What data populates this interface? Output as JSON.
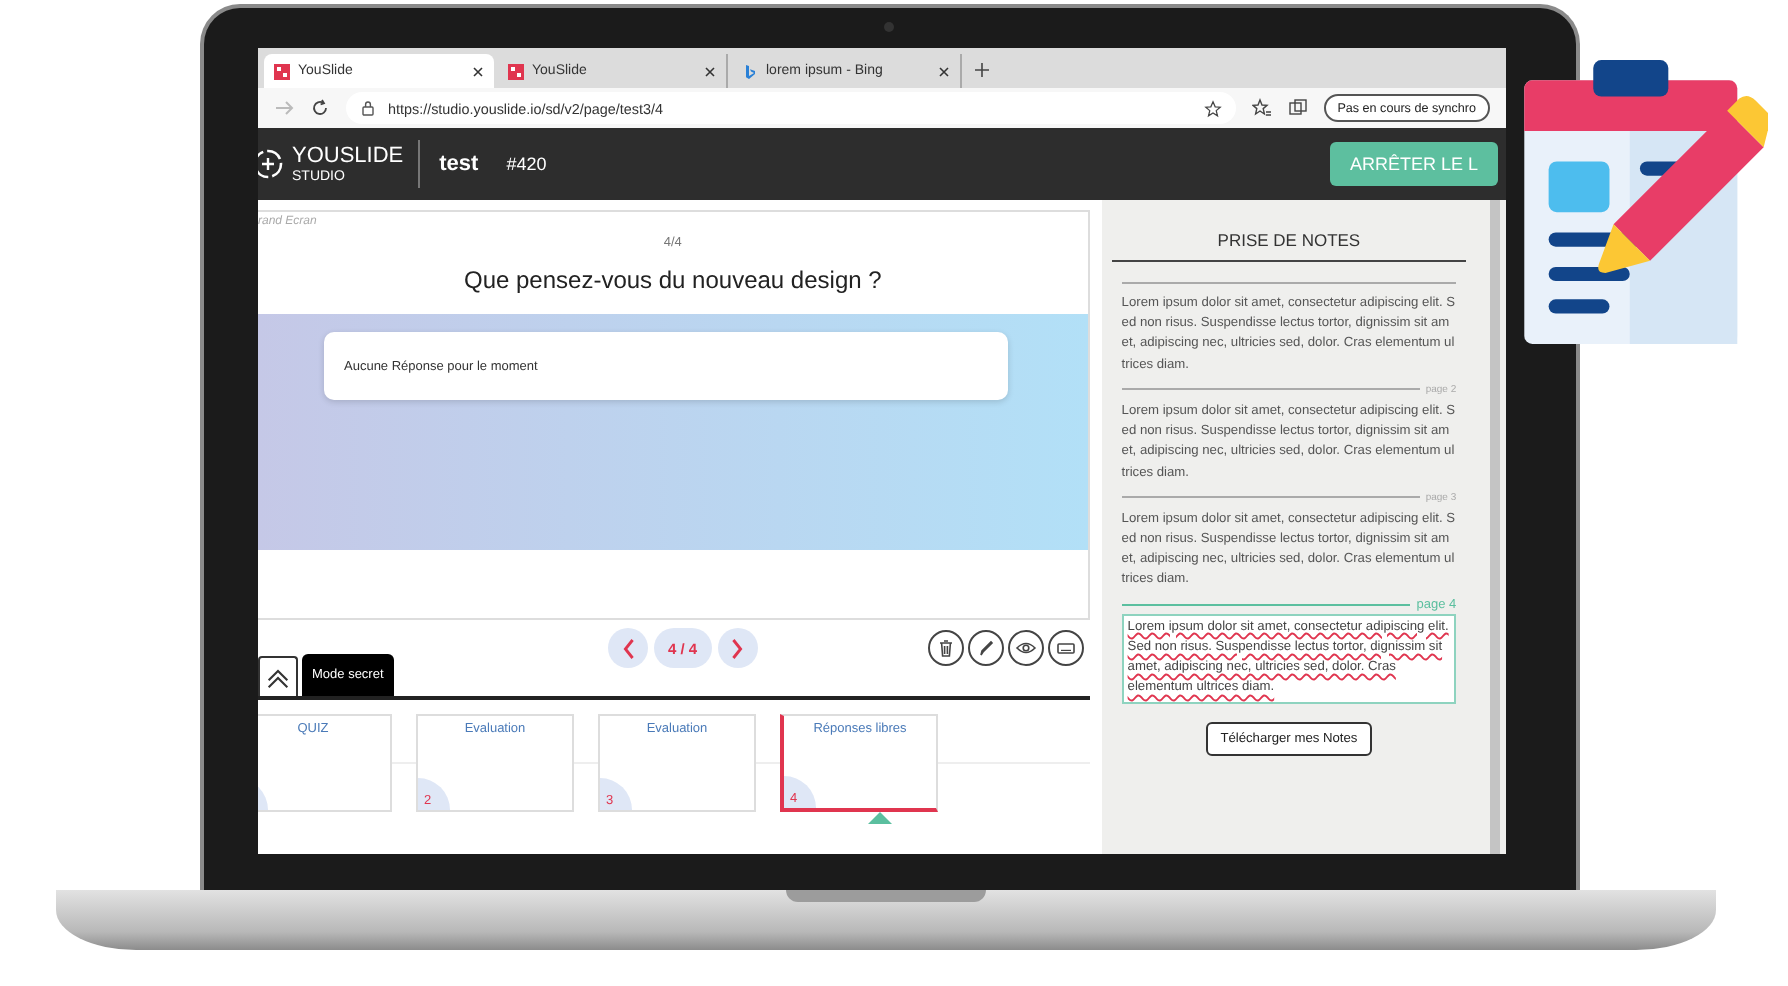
{
  "browser": {
    "tabs": [
      {
        "label": "YouSlide",
        "kind": "youslide",
        "selected": true
      },
      {
        "label": "YouSlide",
        "kind": "youslide",
        "selected": false
      },
      {
        "label": "lorem ipsum - Bing",
        "kind": "bing",
        "selected": false
      }
    ],
    "address": "https://studio.youslide.io/sd/v2/page/test3/4",
    "sync_button": "Pas en cours de synchro"
  },
  "header": {
    "logo_name": "YOUSLIDE",
    "logo_sub": "STUDIO",
    "title": "test",
    "code": "#420",
    "stop_button": "ARRÊTER LE L"
  },
  "slide": {
    "corner_label": "rand Ecran",
    "counter": "4/4",
    "question": "Que pensez-vous du nouveau design ?",
    "message": "Aucune Réponse pour le moment"
  },
  "controls": {
    "mode_button": "Mode secret",
    "page": "4 / 4"
  },
  "thumbnails": [
    {
      "title": "QUIZ",
      "selected": false
    },
    {
      "title": "Evaluation",
      "number": "2",
      "selected": false
    },
    {
      "title": "Evaluation",
      "number": "3",
      "selected": false
    },
    {
      "title": "Réponses libres",
      "number": "4",
      "selected": true
    }
  ],
  "notes": {
    "title": "PRISE DE NOTES",
    "pages": [
      {
        "text": "Lorem ipsum dolor sit amet, consectetur adipiscing elit. Sed non risus. Suspendisse lectus tortor, dignissim sit amet, adipiscing nec, ultricies sed, dolor. Cras elementum ultrices diam.",
        "selected": false
      },
      {
        "label": "page 2",
        "text": "Lorem ipsum dolor sit amet, consectetur adipiscing elit. Sed non risus. Suspendisse lectus tortor, dignissim sit amet, adipiscing nec, ultricies sed, dolor. Cras elementum ultrices diam.",
        "selected": false
      },
      {
        "label": "page 3",
        "text": "Lorem ipsum dolor sit amet, consectetur adipiscing elit. Sed non risus. Suspendisse lectus tortor, dignissim sit amet, adipiscing nec, ultricies sed, dolor. Cras elementum ultrices diam.",
        "selected": false
      },
      {
        "label": "page 4",
        "text": "Lorem ipsum dolor sit amet, consectetur adipiscing elit. Sed non risus. Suspendisse lectus tortor, dignissim sit amet, adipiscing nec, ultricies sed, dolor. Cras elementum ultrices diam.",
        "selected": true
      }
    ],
    "download_button": "Télécharger mes Notes"
  }
}
